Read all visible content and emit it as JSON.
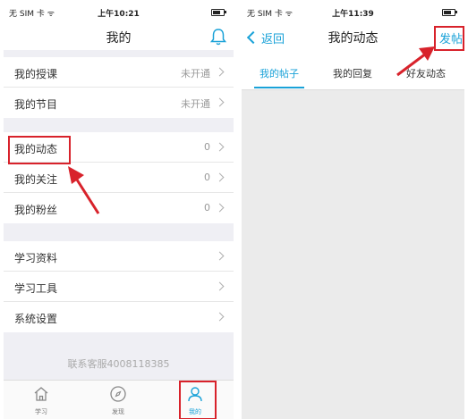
{
  "left": {
    "status": {
      "carrier": "无 SIM 卡 ᯤ",
      "time": "上午10:21"
    },
    "title": "我的",
    "group1": [
      {
        "label": "我的授课",
        "value": "未开通"
      },
      {
        "label": "我的节目",
        "value": "未开通"
      }
    ],
    "group2": [
      {
        "label": "我的动态",
        "value": "0"
      },
      {
        "label": "我的关注",
        "value": "0"
      },
      {
        "label": "我的粉丝",
        "value": "0"
      }
    ],
    "group3": [
      {
        "label": "学习资料"
      },
      {
        "label": "学习工具"
      },
      {
        "label": "系统设置"
      }
    ],
    "service": "联系客服4008118385",
    "tabs": [
      {
        "label": "学习",
        "icon": "home-icon"
      },
      {
        "label": "发现",
        "icon": "compass-icon"
      },
      {
        "label": "我的",
        "icon": "profile-icon"
      }
    ]
  },
  "right": {
    "status": {
      "carrier": "无 SIM 卡 ᯤ",
      "time": "上午11:39"
    },
    "back": "返回",
    "title": "我的动态",
    "post": "发帖",
    "subtabs": [
      "我的帖子",
      "我的回复",
      "好友动态"
    ]
  },
  "colors": {
    "accent": "#1aa2d8",
    "highlight": "#d8222b",
    "section_bg": "#efeff4"
  }
}
